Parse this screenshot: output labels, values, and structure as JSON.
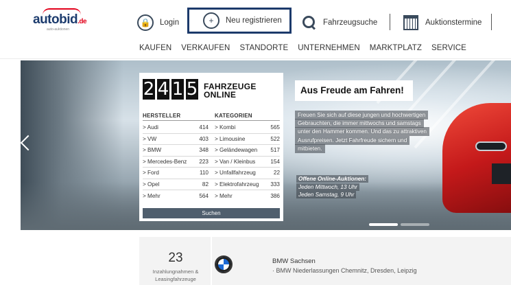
{
  "header": {
    "logo_main": "autobid",
    "logo_tld": ".de",
    "logo_sub": "auto-auktionen",
    "login_label": "Login",
    "register_label": "Neu registrieren",
    "search_label": "Fahrzeugsuche",
    "auctions_label": "Auktionstermine"
  },
  "nav": [
    "KAUFEN",
    "VERKAUFEN",
    "STANDORTE",
    "UNTERNEHMEN",
    "MARKTPLATZ",
    "SERVICE"
  ],
  "stats": {
    "digits": [
      "2",
      "4",
      "1",
      "5"
    ],
    "label_line1": "FAHRZEUGE",
    "label_line2": "ONLINE",
    "col_makes": "HERSTELLER",
    "col_categories": "KATEGORIEN",
    "rows": [
      {
        "make": "> Audi",
        "make_count": "414",
        "cat": "> Kombi",
        "cat_count": "565"
      },
      {
        "make": "> VW",
        "make_count": "403",
        "cat": "> Limousine",
        "cat_count": "522"
      },
      {
        "make": "> BMW",
        "make_count": "348",
        "cat": "> Geländewagen",
        "cat_count": "517"
      },
      {
        "make": "> Mercedes-Benz",
        "make_count": "223",
        "cat": "> Van / Kleinbus",
        "cat_count": "154"
      },
      {
        "make": "> Ford",
        "make_count": "110",
        "cat": "> Unfallfahrzeug",
        "cat_count": "22"
      },
      {
        "make": "> Opel",
        "make_count": "82",
        "cat": "> Elektrofahrzeug",
        "cat_count": "333"
      },
      {
        "make": "> Mehr",
        "make_count": "564",
        "cat": "> Mehr",
        "cat_count": "386"
      }
    ],
    "search_button": "Suchen"
  },
  "promo": {
    "title": "Aus Freude am Fahren!",
    "text": "Freuen Sie sich auf diese jungen und hochwertigen Gebrauchten, die immer mittwochs und samstags unter den Hammer kommen. Und das zu attraktiven Ausrufpreisen. Jetzt Fahrfreude sichern und mitbieten.",
    "auction_head": "Offene Online-Auktionen:",
    "auction_line1": "Jeden Mittwoch, 13 Uhr",
    "auction_line2": "Jeden Samstag, 9 Uhr"
  },
  "bottom": {
    "count": "23",
    "count_label": "Inzahlungnahmen & Leasingfahrzeuge",
    "dealer_name": "BMW Sachsen",
    "dealer_sub": "· BMW Niederlassungen Chemnitz, Dresden, Leipzig"
  },
  "colors": {
    "brand_dark": "#1c3a6b",
    "brand_red": "#e2001a",
    "button": "#4f5e6d"
  },
  "icons": {
    "login": "lock-icon",
    "register": "add-user-icon",
    "search": "search-icon",
    "auctions": "calendar-icon"
  }
}
